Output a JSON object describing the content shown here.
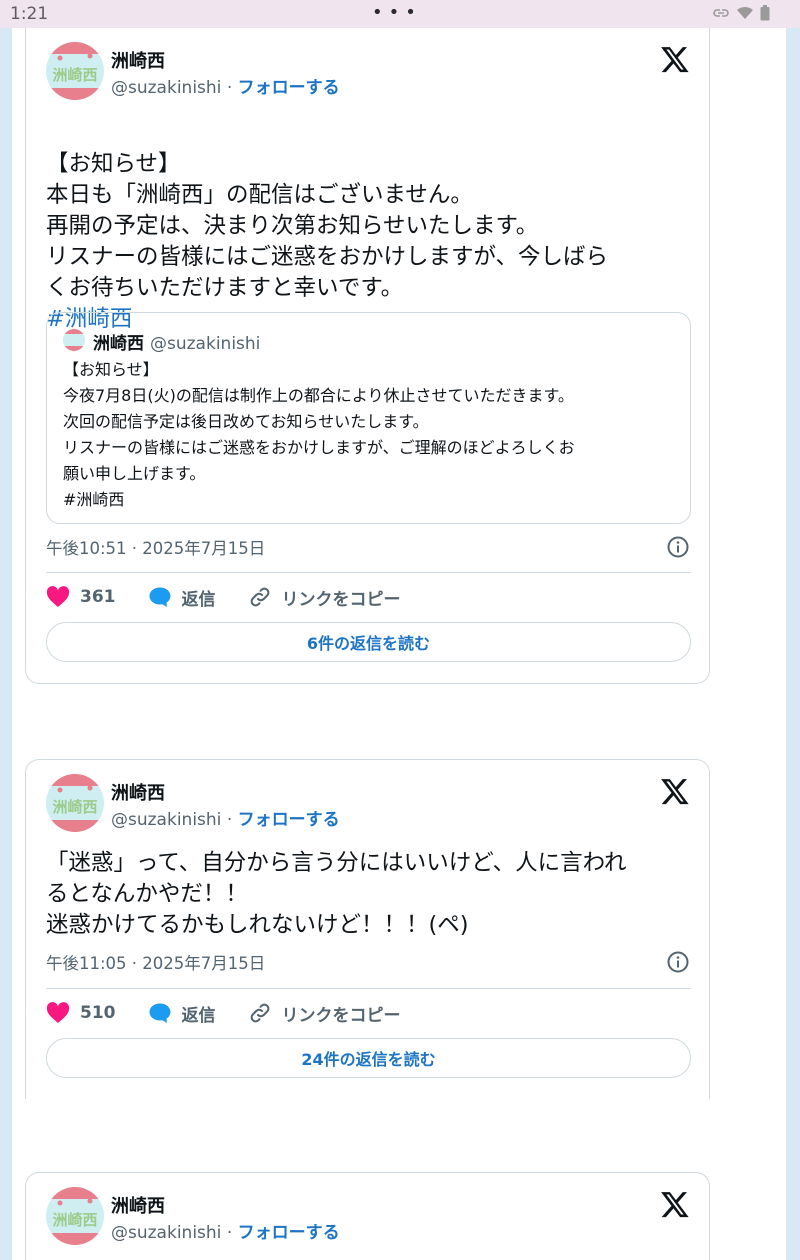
{
  "status_bar": {
    "time": "1:21",
    "menu_dots": "•••"
  },
  "tweets": [
    {
      "author_name": "洲崎西",
      "handle": "@suzakinishi",
      "separator": "·",
      "follow_label": "フォローする",
      "text": "【お知らせ】\n本日も「洲崎西」の配信はございません。\n再開の予定は、決まり次第お知らせいたします。\nリスナーの皆様にはご迷惑をおかけしますが、今しばら\nくお待ちいただけますと幸いです。",
      "hashtag": "#洲崎西",
      "quote": {
        "author_name": "洲崎西",
        "handle": "@suzakinishi",
        "text": "【お知らせ】\n今夜7月8日(火)の配信は制作上の都合により休止させていただきます。\n次回の配信予定は後日改めてお知らせいたします。\nリスナーの皆様にはご迷惑をおかけしますが、ご理解のほどよろしくお\n願い申し上げます。\n#洲崎西"
      },
      "timestamp": "午後10:51 · 2025年7月15日",
      "likes": "361",
      "reply_label": "返信",
      "copy_link_label": "リンクをコピー",
      "read_replies_label": "6件の返信を読む"
    },
    {
      "author_name": "洲崎西",
      "handle": "@suzakinishi",
      "separator": "·",
      "follow_label": "フォローする",
      "text": "「迷惑」って、自分から言う分にはいいけど、人に言われ\nるとなんかやだ！！\n迷惑かけてるかもしれないけど！！！(ペ)",
      "timestamp": "午後11:05 · 2025年7月15日",
      "likes": "510",
      "reply_label": "返信",
      "copy_link_label": "リンクをコピー",
      "read_replies_label": "24件の返信を読む"
    },
    {
      "author_name": "洲崎西",
      "handle": "@suzakinishi",
      "separator": "·",
      "follow_label": "フォローする"
    }
  ],
  "avatar_text": "洲崎西",
  "colors": {
    "like": "#f91880",
    "reply": "#1d9bf0",
    "link": "#1d74c5",
    "status_bar_bg": "#f0e4ef",
    "side_strip": "#d9e8f5"
  },
  "icons": [
    "x-logo-icon",
    "info-icon",
    "heart-icon",
    "speech-bubble-icon",
    "link-icon",
    "wifi-icon",
    "battery-icon",
    "link-status-icon"
  ]
}
